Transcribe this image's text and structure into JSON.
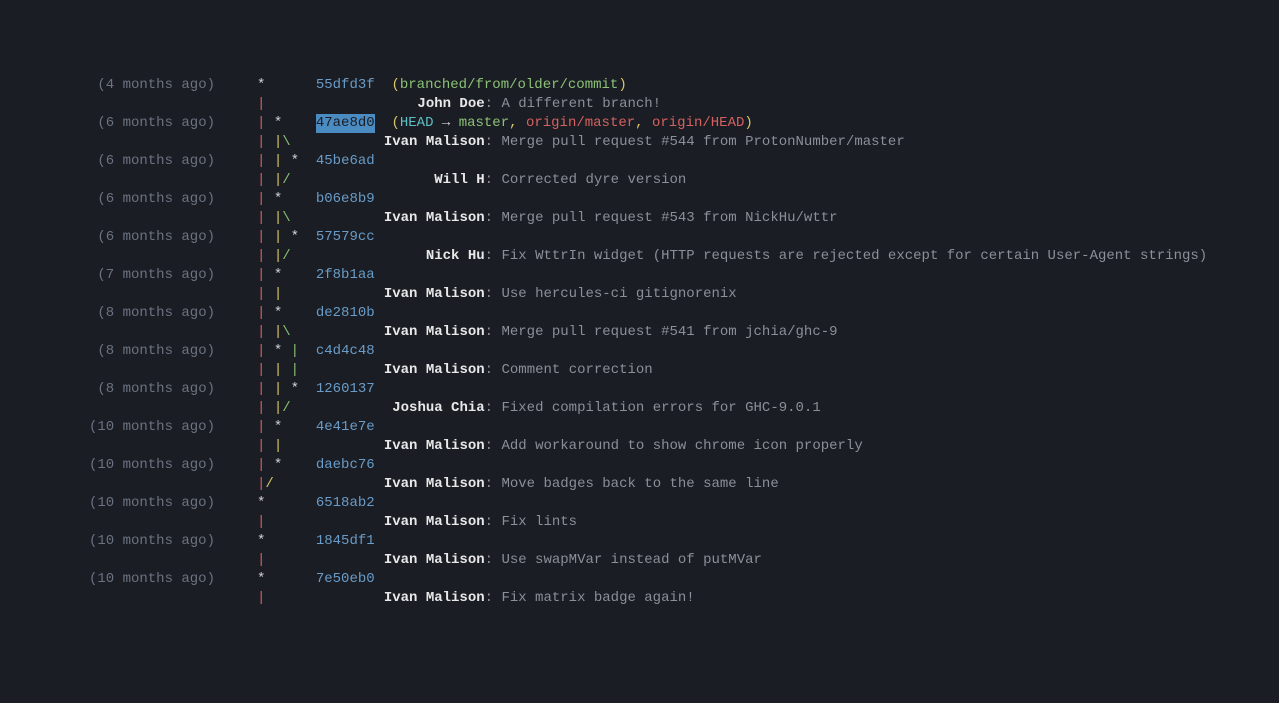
{
  "rows": [
    {
      "age": "(4 months ago)",
      "graph": [
        {
          "t": "*",
          "c": "w"
        }
      ],
      "hash": "55dfd3f",
      "refs": {
        "open": "(",
        "branch": "branched/from/older/commit",
        "close": ")"
      }
    },
    {
      "graph": [
        {
          "t": "|",
          "c": "r"
        }
      ],
      "author": "John Doe",
      "msg": "A different branch!"
    },
    {
      "age": "(6 months ago)",
      "graph": [
        {
          "t": "|",
          "c": "r"
        },
        {
          "t": " ",
          "c": "w"
        },
        {
          "t": "*",
          "c": "w"
        }
      ],
      "hash": "47ae8d0",
      "hl": true,
      "headrefs": {
        "head": "HEAD",
        "arrow": " → ",
        "local": "master",
        "sep1": ", ",
        "r1": "origin/master",
        "sep2": ", ",
        "r2": "origin/HEAD"
      }
    },
    {
      "graph": [
        {
          "t": "|",
          "c": "r"
        },
        {
          "t": " ",
          "c": "w"
        },
        {
          "t": "|",
          "c": "y"
        },
        {
          "t": "\\",
          "c": "g"
        }
      ],
      "author": "Ivan Malison",
      "msg": "Merge pull request #544 from ProtonNumber/master"
    },
    {
      "age": "(6 months ago)",
      "graph": [
        {
          "t": "|",
          "c": "r"
        },
        {
          "t": " ",
          "c": "w"
        },
        {
          "t": "|",
          "c": "y"
        },
        {
          "t": " ",
          "c": "w"
        },
        {
          "t": "*",
          "c": "w"
        }
      ],
      "hash": "45be6ad"
    },
    {
      "graph": [
        {
          "t": "|",
          "c": "r"
        },
        {
          "t": " ",
          "c": "w"
        },
        {
          "t": "|",
          "c": "y"
        },
        {
          "t": "/",
          "c": "g"
        }
      ],
      "author": "Will H",
      "msg": "Corrected dyre version"
    },
    {
      "age": "(6 months ago)",
      "graph": [
        {
          "t": "|",
          "c": "r"
        },
        {
          "t": " ",
          "c": "w"
        },
        {
          "t": "*",
          "c": "w"
        }
      ],
      "hash": "b06e8b9"
    },
    {
      "graph": [
        {
          "t": "|",
          "c": "r"
        },
        {
          "t": " ",
          "c": "w"
        },
        {
          "t": "|",
          "c": "y"
        },
        {
          "t": "\\",
          "c": "g"
        }
      ],
      "author": "Ivan Malison",
      "msg": "Merge pull request #543 from NickHu/wttr"
    },
    {
      "age": "(6 months ago)",
      "graph": [
        {
          "t": "|",
          "c": "r"
        },
        {
          "t": " ",
          "c": "w"
        },
        {
          "t": "|",
          "c": "y"
        },
        {
          "t": " ",
          "c": "w"
        },
        {
          "t": "*",
          "c": "w"
        }
      ],
      "hash": "57579cc"
    },
    {
      "graph": [
        {
          "t": "|",
          "c": "r"
        },
        {
          "t": " ",
          "c": "w"
        },
        {
          "t": "|",
          "c": "y"
        },
        {
          "t": "/",
          "c": "g"
        }
      ],
      "author": "Nick Hu",
      "msg": "Fix WttrIn widget (HTTP requests are rejected except for certain User-Agent strings)"
    },
    {
      "age": "(7 months ago)",
      "graph": [
        {
          "t": "|",
          "c": "r"
        },
        {
          "t": " ",
          "c": "w"
        },
        {
          "t": "*",
          "c": "w"
        }
      ],
      "hash": "2f8b1aa"
    },
    {
      "graph": [
        {
          "t": "|",
          "c": "r"
        },
        {
          "t": " ",
          "c": "w"
        },
        {
          "t": "|",
          "c": "y"
        }
      ],
      "author": "Ivan Malison",
      "msg": "Use hercules-ci gitignorenix"
    },
    {
      "age": "(8 months ago)",
      "graph": [
        {
          "t": "|",
          "c": "r"
        },
        {
          "t": " ",
          "c": "w"
        },
        {
          "t": "*",
          "c": "w"
        }
      ],
      "hash": "de2810b"
    },
    {
      "graph": [
        {
          "t": "|",
          "c": "r"
        },
        {
          "t": " ",
          "c": "w"
        },
        {
          "t": "|",
          "c": "y"
        },
        {
          "t": "\\",
          "c": "g"
        }
      ],
      "author": "Ivan Malison",
      "msg": "Merge pull request #541 from jchia/ghc-9"
    },
    {
      "age": "(8 months ago)",
      "graph": [
        {
          "t": "|",
          "c": "r"
        },
        {
          "t": " ",
          "c": "w"
        },
        {
          "t": "*",
          "c": "w"
        },
        {
          "t": " ",
          "c": "w"
        },
        {
          "t": "|",
          "c": "g"
        }
      ],
      "hash": "c4d4c48"
    },
    {
      "graph": [
        {
          "t": "|",
          "c": "r"
        },
        {
          "t": " ",
          "c": "w"
        },
        {
          "t": "|",
          "c": "y"
        },
        {
          "t": " ",
          "c": "w"
        },
        {
          "t": "|",
          "c": "g"
        }
      ],
      "author": "Ivan Malison",
      "msg": "Comment correction"
    },
    {
      "age": "(8 months ago)",
      "graph": [
        {
          "t": "|",
          "c": "r"
        },
        {
          "t": " ",
          "c": "w"
        },
        {
          "t": "|",
          "c": "y"
        },
        {
          "t": " ",
          "c": "w"
        },
        {
          "t": "*",
          "c": "w"
        }
      ],
      "hash": "1260137"
    },
    {
      "graph": [
        {
          "t": "|",
          "c": "r"
        },
        {
          "t": " ",
          "c": "w"
        },
        {
          "t": "|",
          "c": "y"
        },
        {
          "t": "/",
          "c": "g"
        }
      ],
      "author": "Joshua Chia",
      "msg": "Fixed compilation errors for GHC-9.0.1"
    },
    {
      "age": "(10 months ago)",
      "graph": [
        {
          "t": "|",
          "c": "r"
        },
        {
          "t": " ",
          "c": "w"
        },
        {
          "t": "*",
          "c": "w"
        }
      ],
      "hash": "4e41e7e"
    },
    {
      "graph": [
        {
          "t": "|",
          "c": "r"
        },
        {
          "t": " ",
          "c": "w"
        },
        {
          "t": "|",
          "c": "y"
        }
      ],
      "author": "Ivan Malison",
      "msg": "Add workaround to show chrome icon properly"
    },
    {
      "age": "(10 months ago)",
      "graph": [
        {
          "t": "|",
          "c": "r"
        },
        {
          "t": " ",
          "c": "w"
        },
        {
          "t": "*",
          "c": "w"
        }
      ],
      "hash": "daebc76"
    },
    {
      "graph": [
        {
          "t": "|",
          "c": "r"
        },
        {
          "t": "/",
          "c": "y"
        }
      ],
      "author": "Ivan Malison",
      "msg": "Move badges back to the same line"
    },
    {
      "age": "(10 months ago)",
      "graph": [
        {
          "t": "*",
          "c": "w"
        }
      ],
      "hash": "6518ab2"
    },
    {
      "graph": [
        {
          "t": "|",
          "c": "r"
        }
      ],
      "author": "Ivan Malison",
      "msg": "Fix lints"
    },
    {
      "age": "(10 months ago)",
      "graph": [
        {
          "t": "*",
          "c": "w"
        }
      ],
      "hash": "1845df1"
    },
    {
      "graph": [
        {
          "t": "|",
          "c": "r"
        }
      ],
      "author": "Ivan Malison",
      "msg": "Use swapMVar instead of putMVar"
    },
    {
      "age": "(10 months ago)",
      "graph": [
        {
          "t": "*",
          "c": "w"
        }
      ],
      "hash": "7e50eb0"
    },
    {
      "graph": [
        {
          "t": "|",
          "c": "r"
        }
      ],
      "author": "Ivan Malison",
      "msg": "Fix matrix badge again!"
    }
  ]
}
